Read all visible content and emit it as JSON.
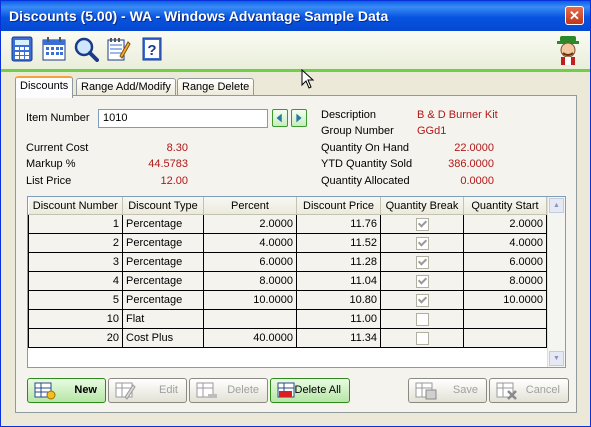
{
  "window": {
    "title": "Discounts (5.00) - WA - Windows Advantage Sample Data",
    "close_symbol": "✕"
  },
  "toolbar": {
    "icons": [
      "calculator-icon",
      "calendar-icon",
      "magnifier-icon",
      "notepad-pencil-icon",
      "help-book-icon"
    ]
  },
  "tabs": [
    {
      "label": "Discounts",
      "active": true
    },
    {
      "label": "Range Add/Modify",
      "active": false
    },
    {
      "label": "Range Delete",
      "active": false
    }
  ],
  "item": {
    "number_label": "Item Number",
    "number_value": "1010",
    "current_cost_label": "Current Cost",
    "current_cost": "8.30",
    "markup_label": "Markup %",
    "markup": "44.5783",
    "list_price_label": "List Price",
    "list_price": "12.00",
    "description_label": "Description",
    "description": "B & D Burner Kit",
    "group_label": "Group Number",
    "group": "GGd1",
    "qoh_label": "Quantity On Hand",
    "qoh": "22.0000",
    "ytd_label": "YTD Quantity Sold",
    "ytd": "386.0000",
    "allocated_label": "Quantity Allocated",
    "allocated": "0.0000"
  },
  "grid": {
    "columns": [
      "Discount Number",
      "Discount Type",
      "Percent",
      "Discount Price",
      "Quantity Break",
      "Quantity Start"
    ],
    "rows": [
      {
        "num": "1",
        "type": "Percentage",
        "percent": "2.0000",
        "price": "11.76",
        "qbreak": true,
        "qstart": "2.0000"
      },
      {
        "num": "2",
        "type": "Percentage",
        "percent": "4.0000",
        "price": "11.52",
        "qbreak": true,
        "qstart": "4.0000"
      },
      {
        "num": "3",
        "type": "Percentage",
        "percent": "6.0000",
        "price": "11.28",
        "qbreak": true,
        "qstart": "6.0000"
      },
      {
        "num": "4",
        "type": "Percentage",
        "percent": "8.0000",
        "price": "11.04",
        "qbreak": true,
        "qstart": "8.0000"
      },
      {
        "num": "5",
        "type": "Percentage",
        "percent": "10.0000",
        "price": "10.80",
        "qbreak": true,
        "qstart": "10.0000"
      },
      {
        "num": "10",
        "type": "Flat",
        "percent": "",
        "price": "11.00",
        "qbreak": false,
        "qstart": ""
      },
      {
        "num": "20",
        "type": "Cost Plus",
        "percent": "40.0000",
        "price": "11.34",
        "qbreak": false,
        "qstart": ""
      }
    ]
  },
  "buttons": {
    "new": "New",
    "edit": "Edit",
    "delete": "Delete",
    "delete_all": "Delete All",
    "save": "Save",
    "cancel": "Cancel"
  }
}
